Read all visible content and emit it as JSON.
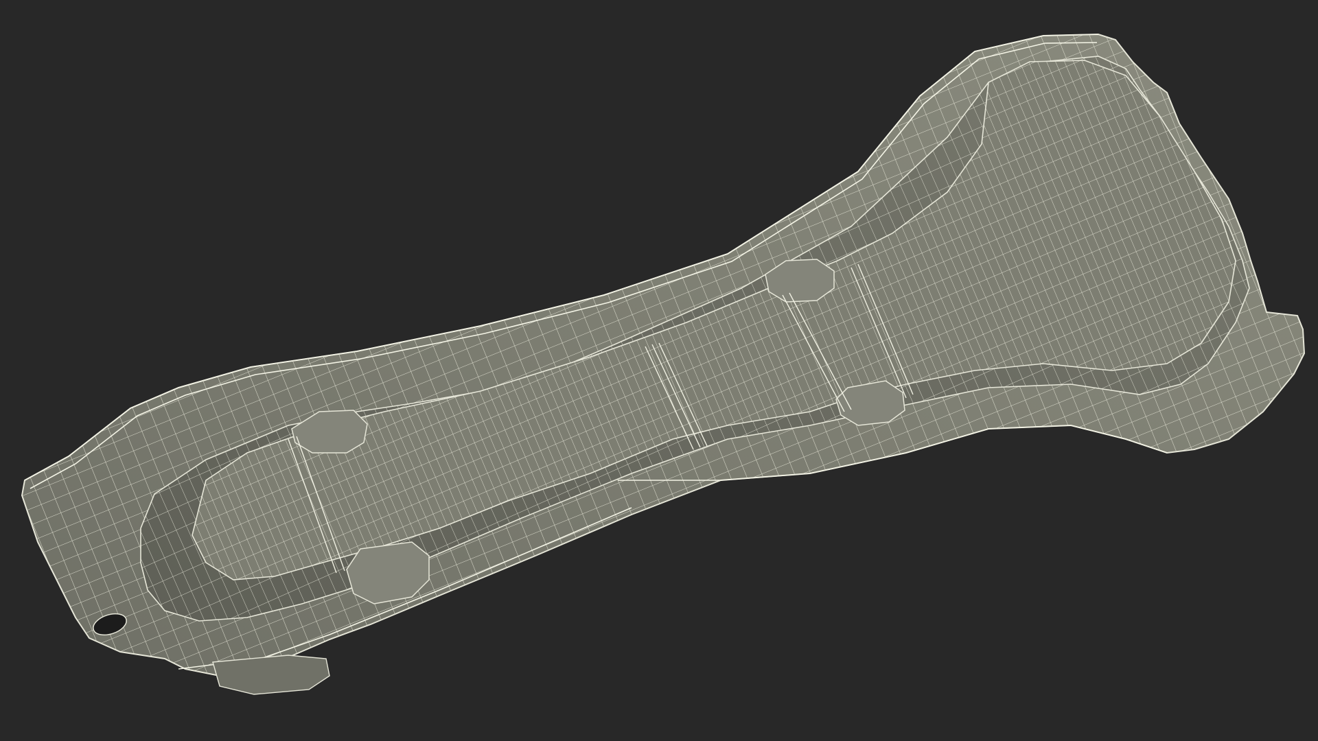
{
  "scene": {
    "background_color": "#282828",
    "model_fill": "#7b7c70",
    "model_shadow": "#5a5b51",
    "model_highlight": "#8f9083",
    "wire_color": "#e6e6d8"
  }
}
